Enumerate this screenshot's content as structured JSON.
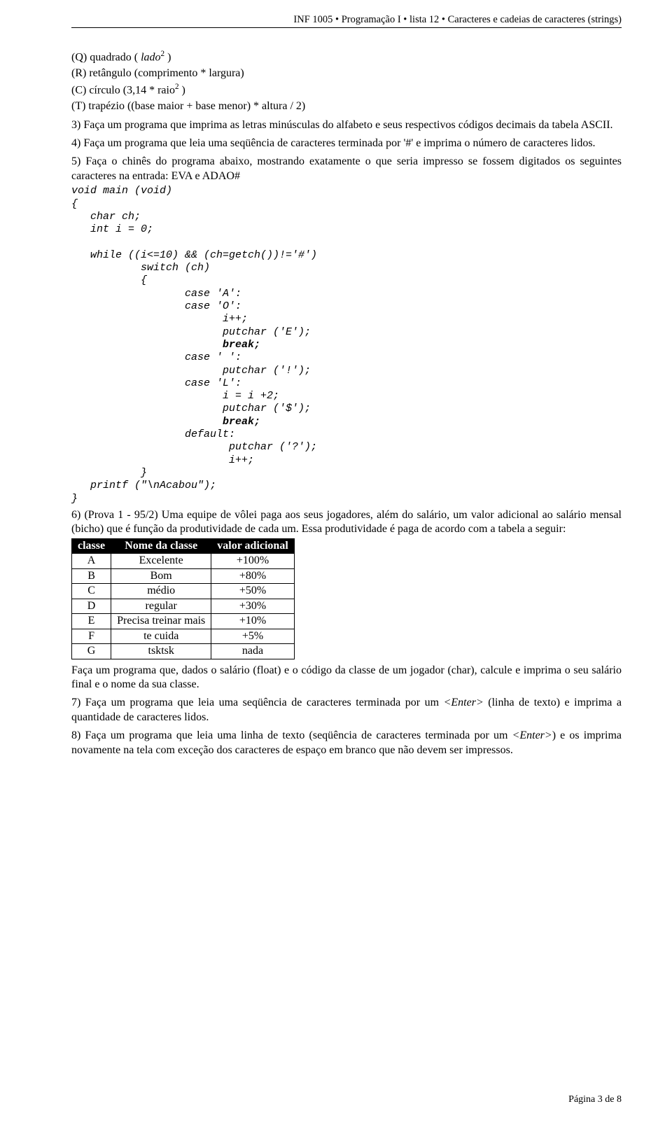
{
  "header": "INF 1005 • Programação I • lista 12 • Caracteres e cadeias de caracteres (strings)",
  "q_line_prefix": "(Q) quadrado ( ",
  "q_line_var": "lado",
  "q_line_exp": "2",
  "q_line_suffix_close": " )",
  "r_line_prefix": "(R) retângulo (comprimento * largura)",
  "c_line_prefix": "(C) círculo (3,14 * raio",
  "c_line_exp": "2",
  "c_line_suffix": " )",
  "t_line": "(T) trapézio ((base maior + base menor) * altura / 2)",
  "ex3": "3)  Faça um programa que imprima as letras minúsculas do alfabeto e seus respectivos códigos decimais da tabela ASCII.",
  "ex4": "4)  Faça um programa que leia uma seqüência de caracteres terminada por '#' e imprima o número de caracteres lidos.",
  "ex5": "5)  Faça o chinês do programa abaixo, mostrando exatamente o que seria impresso se fossem digitados os seguintes caracteres na entrada: EVA e ADAO#",
  "code_l1": "void main (void)",
  "code_l2": "{",
  "code_l3": "   char ch;",
  "code_l4": "   int i = 0;",
  "code_blank": "",
  "code_l5": "   while ((i<=10) && (ch=getch())!='#')",
  "code_l6": "           switch (ch)",
  "code_l7": "           {",
  "code_l8": "                  case 'A':",
  "code_l9": "                  case 'O':",
  "code_l10": "                        i++;",
  "code_l11": "                        putchar ('E');",
  "code_l12_break": "                        break;",
  "code_l13": "                  case ' ':",
  "code_l14": "                        putchar ('!');",
  "code_l15": "                  case 'L':",
  "code_l16": "                        i = i +2;",
  "code_l17": "                        putchar ('$');",
  "code_l18_break": "                        break;",
  "code_l19": "                  default:",
  "code_l20": "                         putchar ('?');",
  "code_l21": "                         i++;",
  "code_l22": "           }",
  "code_l23": "   printf (\"\\nAcabou\");",
  "code_l24": "}",
  "ex6": "6)  (Prova 1 - 95/2) Uma equipe de vôlei paga aos seus jogadores, além do salário, um valor adicional ao salário mensal (bicho) que é função da produtividade de cada um. Essa produtividade é paga de acordo com a tabela a seguir:",
  "table": {
    "header": [
      "classe",
      "Nome da classe",
      "valor adicional"
    ],
    "rows": [
      [
        "A",
        "Excelente",
        "+100%"
      ],
      [
        "B",
        "Bom",
        "+80%"
      ],
      [
        "C",
        "médio",
        "+50%"
      ],
      [
        "D",
        "regular",
        "+30%"
      ],
      [
        "E",
        "Precisa treinar mais",
        "+10%"
      ],
      [
        "F",
        "te cuida",
        "+5%"
      ],
      [
        "G",
        "tsktsk",
        "nada"
      ]
    ]
  },
  "ex6b": "Faça um programa que, dados o salário (float) e o código da classe de um jogador (char), calcule e imprima o seu salário final e o nome da sua classe.",
  "ex7_a": "7)  Faça um programa que leia uma seqüência de caracteres terminada por um ",
  "enter_lt": "<",
  "enter_word": "Enter",
  "enter_gt": ">",
  "ex7_b": " (linha de texto) e imprima a quantidade de caracteres lidos.",
  "ex8_a": "8)  Faça um programa que leia uma linha de texto (seqüência de caracteres terminada por um ",
  "ex8_b": ") e os imprima novamente na tela com exceção dos caracteres de espaço em branco que não devem ser impressos.",
  "footer": "Página 3 de 8"
}
